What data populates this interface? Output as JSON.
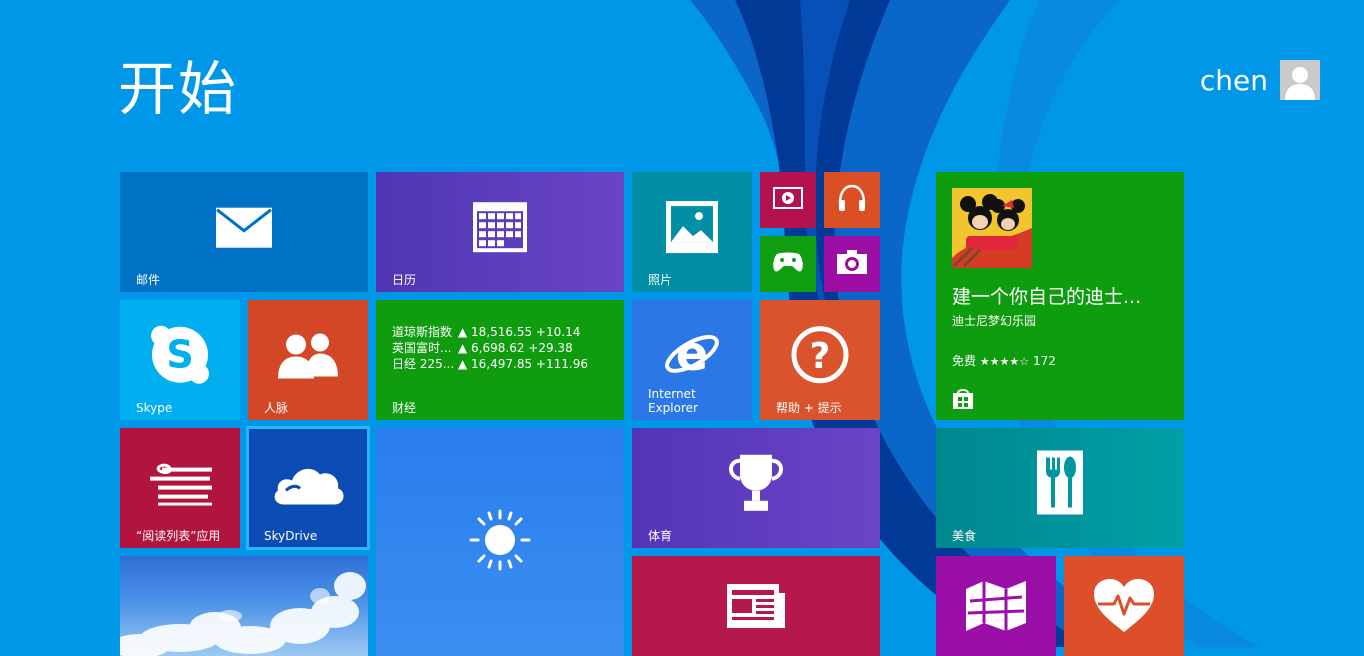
{
  "screen": {
    "title": "开始"
  },
  "user": {
    "name": "chen"
  },
  "colors": {
    "background": "#0097e8",
    "mail": "#0072c6",
    "calendar": "#5a3fbd",
    "photos": "#008fa5",
    "video": "#b3124e",
    "music": "#da4f23",
    "games": "#109e10",
    "camera": "#9b0da4",
    "skype": "#00aff0",
    "people": "#d24726",
    "finance": "#0f9d0f",
    "ie": "#2b77e6",
    "help": "#d9532c",
    "reading": "#b1143c",
    "skydrive": "#0a4cb3",
    "weather": "#2e86ef",
    "sports": "#5d3cbf",
    "news": "#b5184a",
    "store": "#0e9d0e",
    "food": "#00979f",
    "maps": "#9a0fa8",
    "health": "#dc4f2a"
  },
  "tiles": {
    "mail": {
      "label": "邮件",
      "icon": "mail-icon"
    },
    "calendar": {
      "label": "日历",
      "icon": "calendar-icon"
    },
    "photos": {
      "label": "照片",
      "icon": "photos-icon"
    },
    "video": {
      "icon": "video-icon"
    },
    "music": {
      "icon": "headphones-icon"
    },
    "games": {
      "icon": "xbox-controller-icon"
    },
    "camera": {
      "icon": "camera-icon"
    },
    "skype": {
      "label": "Skype",
      "icon": "skype-icon"
    },
    "people": {
      "label": "人脉",
      "icon": "people-icon"
    },
    "finance": {
      "label": "财经",
      "quotes": [
        {
          "name": "道琼斯指数",
          "value": "▲ 18,516.55 +10.14"
        },
        {
          "name": "英国富时...",
          "value": "▲ 6,698.62 +29.38"
        },
        {
          "name": "日经 225...",
          "value": "▲ 16,497.85 +111.96"
        }
      ]
    },
    "ie": {
      "label_line1": "Internet",
      "label_line2": "Explorer",
      "icon": "internet-explorer-icon"
    },
    "help": {
      "label": "帮助 + 提示",
      "icon": "help-icon"
    },
    "reading_list": {
      "label": "“阅读列表”应用",
      "icon": "reading-list-icon"
    },
    "skydrive": {
      "label": "SkyDrive",
      "icon": "cloud-icon"
    },
    "desktop": {
      "icon": "sky-wallpaper"
    },
    "weather": {
      "icon": "sun-icon"
    },
    "sports": {
      "label": "体育",
      "icon": "trophy-icon"
    },
    "news": {
      "icon": "news-icon"
    },
    "store_app": {
      "title": "建一个你自己的迪士...",
      "subtitle": "迪士尼梦幻乐园",
      "price": "免费",
      "stars": "★★★★☆",
      "rating_count": "172",
      "icon": "store-icon"
    },
    "food": {
      "label": "美食",
      "icon": "fork-spoon-icon"
    },
    "maps": {
      "icon": "map-icon"
    },
    "health": {
      "icon": "heart-pulse-icon"
    }
  }
}
